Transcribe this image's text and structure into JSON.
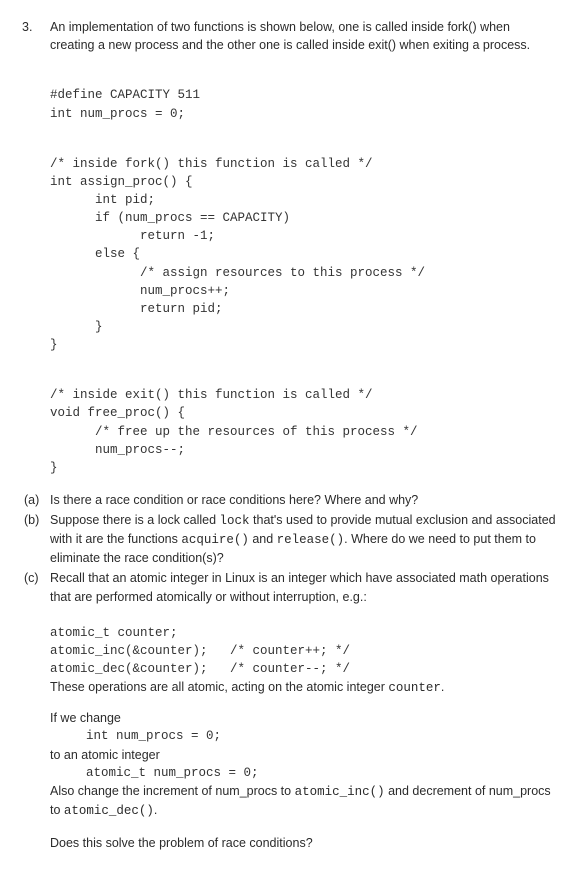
{
  "question_number": "3.",
  "stem": "An implementation of two functions is shown below, one is called inside fork() when creating a new process and the other one is called inside exit() when exiting a process.",
  "code1_l1": "#define CAPACITY 511",
  "code1_l2": "int num_procs = 0;",
  "code2_l1": "/* inside fork() this function is called */",
  "code2_l2": "int assign_proc() {",
  "code2_l3": "      int pid;",
  "code2_l4": "      if (num_procs == CAPACITY)",
  "code2_l5": "            return -1;",
  "code2_l6": "      else {",
  "code2_l7": "            /* assign resources to this process */",
  "code2_l8": "            num_procs++;",
  "code2_l9": "            return pid;",
  "code2_l10": "      }",
  "code2_l11": "}",
  "code3_l1": "/* inside exit() this function is called */",
  "code3_l2": "void free_proc() {",
  "code3_l3": "      /* free up the resources of this process */",
  "code3_l4": "      num_procs--;",
  "code3_l5": "}",
  "parts": {
    "a": {
      "label": "(a)",
      "text": "Is there a race condition or race conditions here?  Where and why?"
    },
    "b": {
      "label": "(b)",
      "pre": "Suppose there is a lock called ",
      "code1": "lock",
      "mid1": " that's used to provide mutual exclusion and associated with it are the functions ",
      "code2": "acquire()",
      "mid2": " and ",
      "code3": "release()",
      "post": ".  Where do we need to put them to eliminate the race condition(s)?"
    },
    "c": {
      "label": "(c)",
      "text": "Recall that an atomic integer in Linux is an integer which have associated math operations that are performed atomically or without interruption, e.g.:",
      "code_l1": "atomic_t counter;",
      "code_l2": "atomic_inc(&counter);   /* counter++; */",
      "code_l3": "atomic_dec(&counter);   /* counter--; */",
      "after1_pre": "These operations are all atomic, acting on the atomic integer ",
      "after1_code": "counter",
      "after1_post": ".",
      "ifwechange": "If we change",
      "orig_decl": "int num_procs = 0;",
      "toatomic": "to an atomic integer",
      "new_decl": "atomic_t num_procs = 0;",
      "also_pre": "Also change the increment of num_procs to ",
      "also_code1": "atomic_inc()",
      "also_mid": " and decrement of num_procs to ",
      "also_code2": "atomic_dec()",
      "also_post": ".",
      "final": "Does this solve the problem of race conditions?"
    }
  }
}
